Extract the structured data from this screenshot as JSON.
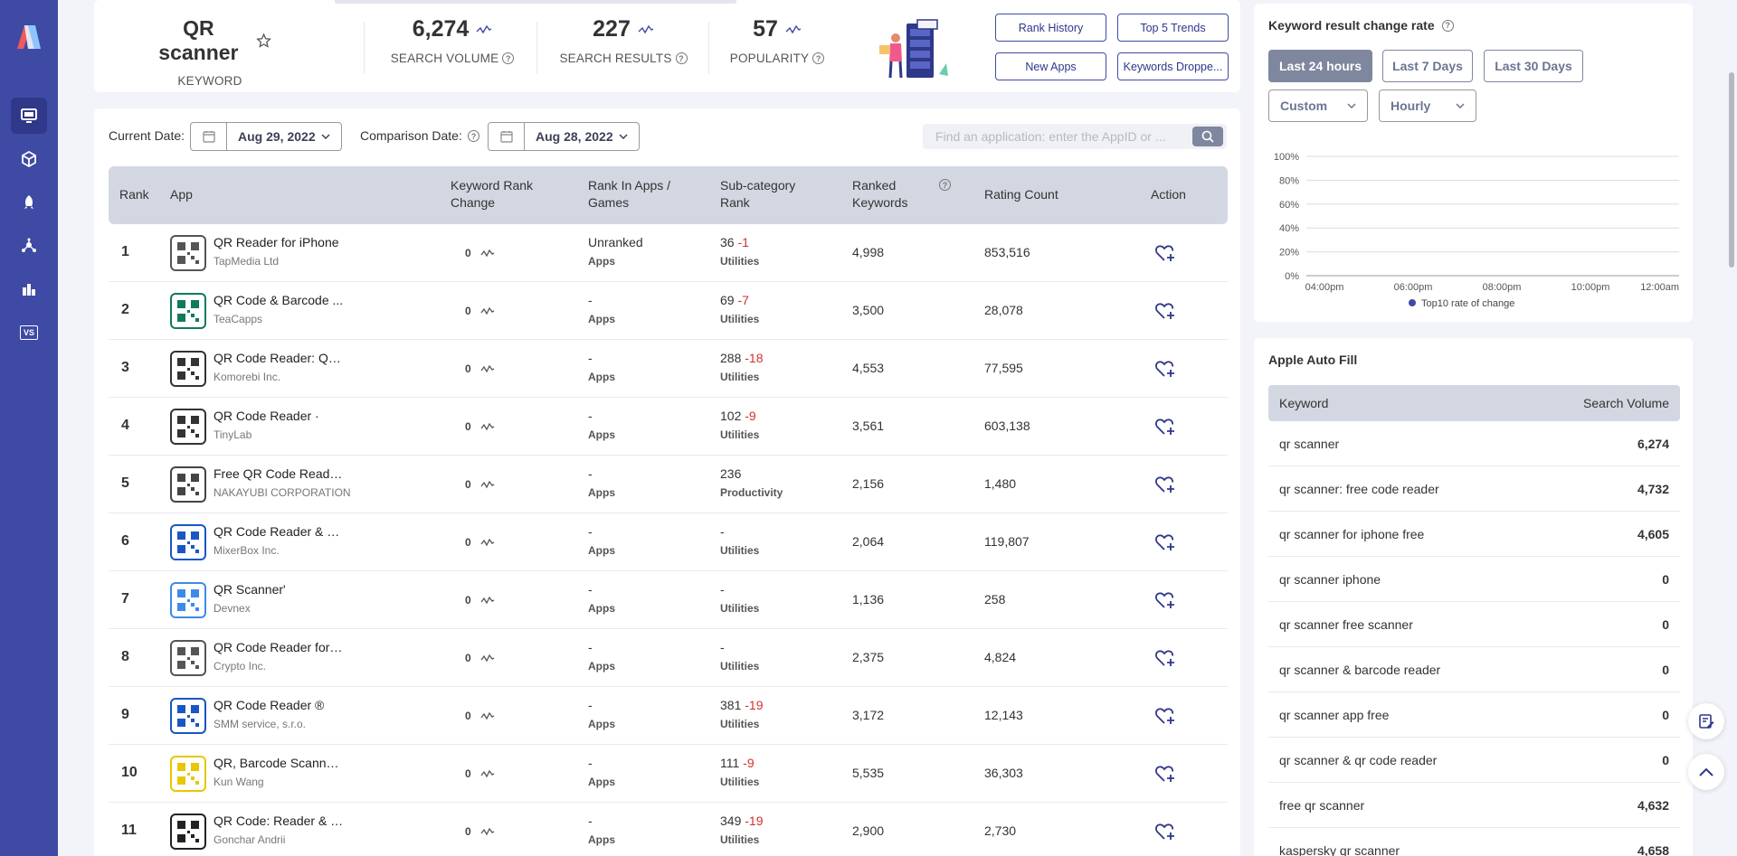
{
  "keyword": {
    "name": "QR scanner",
    "label": "KEYWORD"
  },
  "metrics": {
    "search_volume": {
      "value": "6,274",
      "label": "SEARCH VOLUME"
    },
    "search_results": {
      "value": "227",
      "label": "SEARCH RESULTS"
    },
    "popularity": {
      "value": "57",
      "label": "POPULARITY"
    }
  },
  "top_buttons": {
    "rank_history": "Rank History",
    "top5_trends": "Top 5 Trends",
    "new_apps": "New Apps",
    "keywords_dropped": "Keywords Droppe..."
  },
  "filters": {
    "current_date_label": "Current Date:",
    "current_date": "Aug 29, 2022",
    "comparison_date_label": "Comparison Date:",
    "comparison_date": "Aug 28, 2022",
    "search_placeholder": "Find an application: enter the AppID or ..."
  },
  "table": {
    "headers": {
      "rank": "Rank",
      "app": "App",
      "krc_1": "Keyword Rank",
      "krc_2": "Change",
      "ria_1": "Rank In Apps /",
      "ria_2": "Games",
      "sub_1": "Sub-category",
      "sub_2": "Rank",
      "rk_1": "Ranked",
      "rk_2": "Keywords",
      "rating": "Rating Count",
      "action": "Action"
    },
    "rows": [
      {
        "rank": "1",
        "name": "QR Reader for iPhone",
        "dev": "TapMedia Ltd",
        "krc": "0",
        "ria": "Unranked",
        "ria_sub": "Apps",
        "sub": "36",
        "sub_delta": "-1",
        "sub_cat": "Utilities",
        "rk": "4,998",
        "rc": "853,516",
        "icon": "qr-reader-iphone-icon"
      },
      {
        "rank": "2",
        "name": "QR Code & Barcode ...",
        "dev": "TeaCapps",
        "krc": "0",
        "ria": "-",
        "ria_sub": "Apps",
        "sub": "69",
        "sub_delta": "-7",
        "sub_cat": "Utilities",
        "rk": "3,500",
        "rc": "28,078",
        "icon": "qr-code-barcode-icon"
      },
      {
        "rank": "3",
        "name": "QR Code Reader: Qui...",
        "dev": "Komorebi Inc.",
        "krc": "0",
        "ria": "-",
        "ria_sub": "Apps",
        "sub": "288",
        "sub_delta": "-18",
        "sub_cat": "Utilities",
        "rk": "4,553",
        "rc": "77,595",
        "icon": "qr-code-reader-icon"
      },
      {
        "rank": "4",
        "name": "QR Code Reader ·",
        "dev": "TinyLab",
        "krc": "0",
        "ria": "-",
        "ria_sub": "Apps",
        "sub": "102",
        "sub_delta": "-9",
        "sub_cat": "Utilities",
        "rk": "3,561",
        "rc": "603,138",
        "icon": "qr-code-reader-tinylab-icon"
      },
      {
        "rank": "5",
        "name": "Free QR Code Reade...",
        "dev": "NAKAYUBI CORPORATION",
        "krc": "0",
        "ria": "-",
        "ria_sub": "Apps",
        "sub": "236",
        "sub_delta": "",
        "sub_cat": "Productivity",
        "rk": "2,156",
        "rc": "1,480",
        "icon": "free-qr-code-reader-icon"
      },
      {
        "rank": "6",
        "name": "QR Code Reader & Q...",
        "dev": "MixerBox Inc.",
        "krc": "0",
        "ria": "-",
        "ria_sub": "Apps",
        "sub": "-",
        "sub_delta": "",
        "sub_cat": "Utilities",
        "rk": "2,064",
        "rc": "119,807",
        "icon": "mixerbox-qr-icon"
      },
      {
        "rank": "7",
        "name": "QR Scanner'",
        "dev": "Devnex",
        "krc": "0",
        "ria": "-",
        "ria_sub": "Apps",
        "sub": "-",
        "sub_delta": "",
        "sub_cat": "Utilities",
        "rk": "1,136",
        "rc": "258",
        "icon": "devnex-qr-scanner-icon"
      },
      {
        "rank": "8",
        "name": "QR Code Reader for i...",
        "dev": "Crypto Inc.",
        "krc": "0",
        "ria": "-",
        "ria_sub": "Apps",
        "sub": "-",
        "sub_delta": "",
        "sub_cat": "Utilities",
        "rk": "2,375",
        "rc": "4,824",
        "icon": "crypto-qr-reader-icon"
      },
      {
        "rank": "9",
        "name": "QR Code Reader ®",
        "dev": "SMM service, s.r.o.",
        "krc": "0",
        "ria": "-",
        "ria_sub": "Apps",
        "sub": "381",
        "sub_delta": "-19",
        "sub_cat": "Utilities",
        "rk": "3,172",
        "rc": "12,143",
        "icon": "smm-qr-reader-icon"
      },
      {
        "rank": "10",
        "name": "QR, Barcode Scanner...",
        "dev": "Kun Wang",
        "krc": "0",
        "ria": "-",
        "ria_sub": "Apps",
        "sub": "111",
        "sub_delta": "-9",
        "sub_cat": "Utilities",
        "rk": "5,535",
        "rc": "36,303",
        "icon": "qr-barcode-scanner-icon"
      },
      {
        "rank": "11",
        "name": "QR Code: Reader & G...",
        "dev": "Gonchar Andrii",
        "krc": "0",
        "ria": "-",
        "ria_sub": "Apps",
        "sub": "349",
        "sub_delta": "-19",
        "sub_cat": "Utilities",
        "rk": "2,900",
        "rc": "2,730",
        "icon": "qr-code-reader-generator-icon"
      }
    ]
  },
  "rate_card": {
    "title": "Keyword result change rate",
    "buttons": {
      "h24": "Last 24 hours",
      "d7": "Last 7 Days",
      "d30": "Last 30 Days"
    },
    "custom": "Custom",
    "interval": "Hourly"
  },
  "chart_data": {
    "type": "line",
    "y_ticks": [
      "100%",
      "80%",
      "60%",
      "40%",
      "20%",
      "0%"
    ],
    "x_ticks": [
      "04:00pm",
      "06:00pm",
      "08:00pm",
      "10:00pm",
      "12:00am"
    ],
    "ylim": [
      0,
      100
    ],
    "series": [
      {
        "name": "Top10 rate of change",
        "values": []
      }
    ],
    "legend_position": "bottom",
    "grid": true,
    "series_color": "#3f4aa5"
  },
  "autofill": {
    "title": "Apple Auto Fill",
    "col_keyword": "Keyword",
    "col_volume": "Search Volume",
    "rows": [
      {
        "keyword": "qr scanner",
        "volume": "6,274"
      },
      {
        "keyword": "qr scanner: free code reader",
        "volume": "4,732"
      },
      {
        "keyword": "qr scanner for iphone free",
        "volume": "4,605"
      },
      {
        "keyword": "qr scanner iphone",
        "volume": "0"
      },
      {
        "keyword": "qr scanner free scanner",
        "volume": "0"
      },
      {
        "keyword": "qr scanner & barcode reader",
        "volume": "0"
      },
      {
        "keyword": "qr scanner app free",
        "volume": "0"
      },
      {
        "keyword": "qr scanner & qr code reader",
        "volume": "0"
      },
      {
        "keyword": "free qr scanner",
        "volume": "4,632"
      },
      {
        "keyword": "kaspersky qr scanner",
        "volume": "4,658"
      }
    ]
  },
  "sidebar": {
    "items": [
      {
        "icon": "monitor-icon",
        "active": true
      },
      {
        "icon": "cube-icon",
        "active": false
      },
      {
        "icon": "rocket-icon",
        "active": false
      },
      {
        "icon": "network-icon",
        "active": false
      },
      {
        "icon": "bar-chart-icon",
        "active": false
      },
      {
        "icon": "vs-icon",
        "active": false,
        "text": "VS"
      }
    ]
  },
  "colors": {
    "sidebar": "#3f4aa5",
    "negative": "#d0322f",
    "header_bg": "#d2d7e2",
    "button_active": "#7e879e"
  }
}
